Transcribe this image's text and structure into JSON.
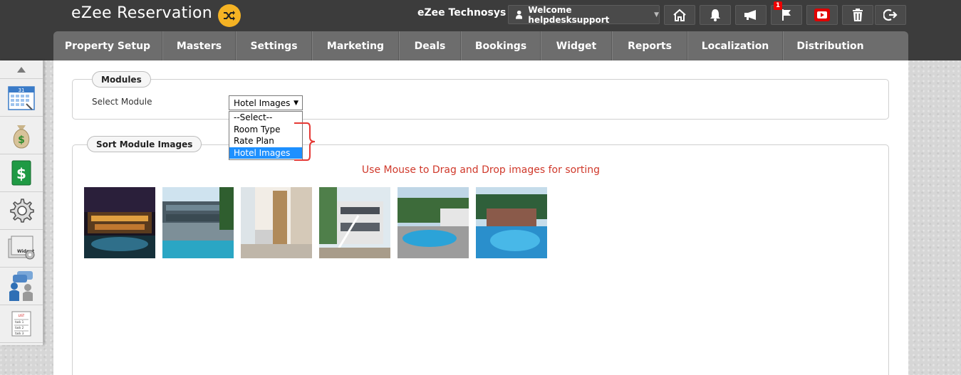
{
  "app": {
    "title": "eZee Reservation",
    "company": "eZee Technosys",
    "welcome": "Welcome helpdesksupport",
    "notification_count": "1"
  },
  "header_icons": [
    "home-icon",
    "bell-icon",
    "megaphone-icon",
    "flag-icon",
    "youtube-icon",
    "trash-icon",
    "logout-icon"
  ],
  "nav": {
    "items": [
      {
        "label": "Property Setup"
      },
      {
        "label": "Masters"
      },
      {
        "label": "Settings"
      },
      {
        "label": "Marketing"
      },
      {
        "label": "Deals"
      },
      {
        "label": "Bookings"
      },
      {
        "label": "Widget"
      },
      {
        "label": "Reports"
      },
      {
        "label": "Localization"
      },
      {
        "label": "Distribution"
      }
    ]
  },
  "sidebar": {
    "items": [
      "calendar-icon",
      "money-bag-icon",
      "dollar-icon",
      "gear-icon",
      "widget-icon",
      "users-chat-icon",
      "task-list-icon"
    ],
    "calendar_day": "31",
    "widget_label": "Widget",
    "tasks": [
      "LIST",
      "task 1",
      "task 2",
      "task 3"
    ]
  },
  "modules": {
    "legend": "Modules",
    "select_label": "Select Module",
    "selected_value": "Hotel Images",
    "options": [
      "--Select--",
      "Room Type",
      "Rate Plan",
      "Hotel Images"
    ],
    "highlighted_option": "Hotel Images"
  },
  "sort": {
    "legend": "Sort Module Images",
    "instruction": "Use Mouse to Drag and Drop images for sorting",
    "instruction_color": "#d0392b",
    "images": [
      "hotel-image-1",
      "hotel-image-2",
      "hotel-image-3",
      "hotel-image-4",
      "hotel-image-5",
      "hotel-image-6"
    ]
  },
  "colors": {
    "header": "#3c3c3c",
    "nav": "#6d6d6d",
    "accent_badge": "#f5b324",
    "selection": "#1e90ff",
    "youtube": "#e00000"
  }
}
